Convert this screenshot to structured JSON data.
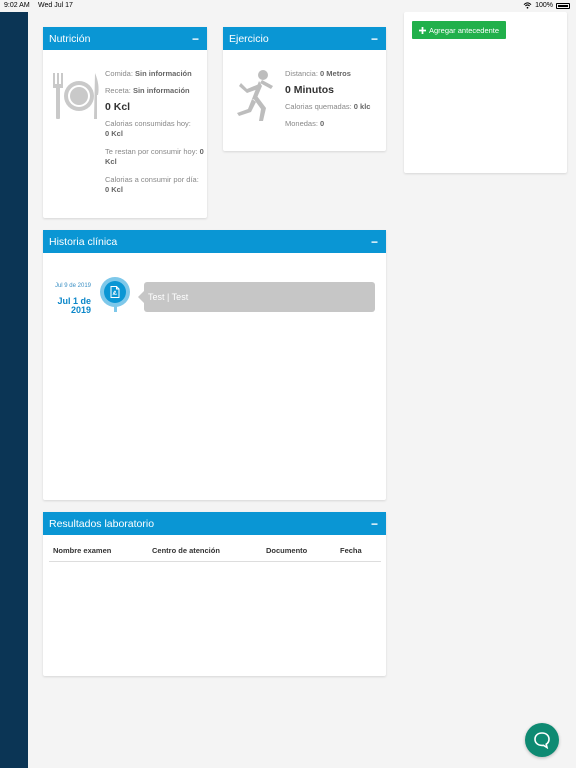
{
  "status_bar": {
    "time": "9:02 AM",
    "date": "Wed Jul 17",
    "battery": "100%"
  },
  "nutricion": {
    "title": "Nutrición",
    "collapse": "−",
    "comida_label": "Comida:",
    "comida_value": "Sin información",
    "receta_label": "Receta:",
    "receta_value": "Sin información",
    "kcal": "0 Kcl",
    "consumidas_label": "Calorias consumidas hoy:",
    "consumidas_value": "0 Kcl",
    "restan_label": "Te restan por consumir hoy:",
    "restan_value": "0 Kcl",
    "por_dia_label": "Calorias a consumir por día:",
    "por_dia_value": "0 Kcl"
  },
  "ejercicio": {
    "title": "Ejercicio",
    "collapse": "−",
    "distancia_label": "Distancia:",
    "distancia_value": "0 Metros",
    "minutos": "0 Minutos",
    "quemadas_label": "Calorias quemadas:",
    "quemadas_value": "0 klc",
    "monedas_label": "Monedas:",
    "monedas_value": "0"
  },
  "antecedentes": {
    "add_label": "Agregar antecedente"
  },
  "historia": {
    "title": "Historia clínica",
    "collapse": "−",
    "entry": {
      "date_small": "Jul 9 de 2019",
      "date_big": "Jul 1 de 2019",
      "text": "Test | Test"
    }
  },
  "laboratorio": {
    "title": "Resultados laboratorio",
    "collapse": "−",
    "columns": [
      "Nombre examen",
      "Centro de atención",
      "Documento",
      "Fecha"
    ]
  },
  "colors": {
    "primary": "#0a96d4",
    "sidebar": "#0b3555",
    "success": "#21b04b",
    "chat": "#0e8a72"
  },
  "icons": [
    "wifi-icon",
    "battery-icon",
    "plate-icon",
    "runner-icon",
    "plus-icon",
    "pdf-icon",
    "chat-icon"
  ]
}
